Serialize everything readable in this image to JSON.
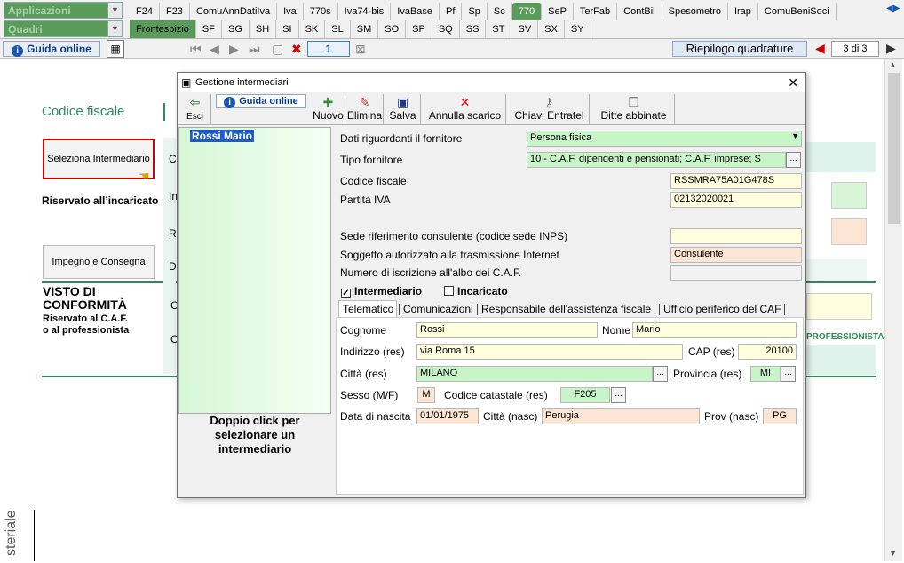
{
  "topbar": {
    "combo1": "Applicazioni",
    "combo2": "Quadri",
    "tabs_row1": [
      "F24",
      "F23",
      "ComuAnnDatiIva",
      "Iva",
      "770s",
      "Iva74-bis",
      "IvaBase",
      "Pf",
      "Sp",
      "Sc",
      "770",
      "SeP",
      "TerFab",
      "ContBil",
      "Spesometro",
      "Irap",
      "ComuBeniSoci"
    ],
    "tabs_row2": [
      "Frontespizio",
      "SF",
      "SG",
      "SH",
      "SI",
      "SK",
      "SL",
      "SM",
      "SO",
      "SP",
      "SQ",
      "SS",
      "ST",
      "SV",
      "SX",
      "SY"
    ]
  },
  "bar2": {
    "guida": "Guida online",
    "page_field": "1",
    "riepilogo": "Riepilogo quadrature",
    "page_counter": "3 di 3"
  },
  "form": {
    "codice_fiscale": "Codice fiscale",
    "seleziona": "Seleziona Intermediario",
    "riservato": "Riservato all’incaricato",
    "impegno": "Impegno e Consegna",
    "visto1": "VISTO DI",
    "visto2": "CONFORMITÀ",
    "visto3": "Riservato al C.A.F.",
    "visto4": "o al professionista",
    "professionista": "PROFESSIONISTA",
    "ministeriale": "steriale",
    "partial_c": "C",
    "partial_i": "In",
    "partial_r": "R",
    "partial_d": "D",
    "partial_c2": "C",
    "partial_c3": "C"
  },
  "dialog": {
    "title": "Gestione intermediari",
    "toolbar": {
      "esci": "Esci",
      "guida": "Guida online",
      "nuovo": "Nuovo",
      "elimina": "Elimina",
      "salva": "Salva",
      "annulla": "Annulla scarico",
      "chiavi": "Chiavi Entratel",
      "ditte": "Ditte abbinate"
    },
    "list": {
      "items": [
        "Rossi  Mario"
      ],
      "hint": "Doppio click per selezionare un intermediario"
    },
    "labels": {
      "dati_fornitore": "Dati riguardanti il fornitore",
      "tipo_fornitore": "Tipo fornitore",
      "codice_fiscale": "Codice fiscale",
      "partita_iva": "Partita IVA",
      "sede": "Sede riferimento consulente (codice sede INPS)",
      "soggetto": "Soggetto autorizzato alla trasmissione Internet",
      "numero": "Numero di iscrizione all'albo dei C.A.F.",
      "intermediario": "Intermediario",
      "incaricato": "Incaricato",
      "cognome": "Cognome",
      "nome": "Nome",
      "indirizzo": "Indirizzo (res)",
      "cap": "CAP (res)",
      "citta": "Città (res)",
      "provincia": "Provincia (res)",
      "sesso": "Sesso (M/F)",
      "codice_catastale": "Codice catastale (res)",
      "data_nascita": "Data di nascita",
      "citta_nasc": "Città (nasc)",
      "prov_nasc": "Prov (nasc)"
    },
    "values": {
      "dati_fornitore": "Persona fisica",
      "tipo_fornitore": "10 - C.A.F. dipendenti e pensionati; C.A.F. imprese; S",
      "codice_fiscale": "RSSMRA75A01G478S",
      "partita_iva": "02132020021",
      "sede": "",
      "soggetto": "Consulente",
      "numero": "",
      "intermediario_checked": true,
      "incaricato_checked": false,
      "cognome": "Rossi",
      "nome": "Mario",
      "indirizzo": "via Roma 15",
      "cap": "20100",
      "citta": "MILANO",
      "provincia": "MI",
      "sesso": "M",
      "codice_catastale": "F205",
      "data_nascita": "01/01/1975",
      "citta_nasc": "Perugia",
      "prov_nasc": "PG"
    },
    "subtabs": [
      "Telematico",
      "Comunicazioni",
      "Responsabile dell'assistenza fiscale",
      "Ufficio periferico del CAF"
    ],
    "dots": "..."
  }
}
